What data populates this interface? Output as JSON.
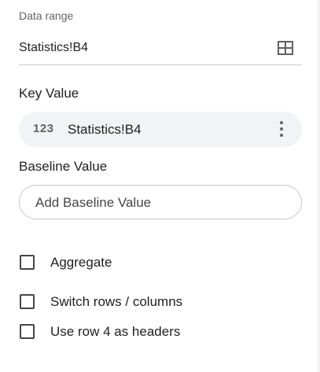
{
  "data_range": {
    "label": "Data range",
    "value": "Statistics!B4",
    "select_icon": "grid-icon"
  },
  "key_value": {
    "title": "Key Value",
    "chip_type_icon": "123",
    "chip_label": "Statistics!B4",
    "menu_icon": "more-vert-icon"
  },
  "baseline_value": {
    "title": "Baseline Value",
    "placeholder": "Add Baseline Value"
  },
  "options": [
    {
      "label": "Aggregate",
      "checked": false
    },
    {
      "label": "Switch rows / columns",
      "checked": false
    },
    {
      "label": "Use row 4 as headers",
      "checked": false
    }
  ],
  "colors": {
    "text": "#202124",
    "muted": "#5f6368",
    "chip_bg": "#f1f3f4",
    "border": "#c7c7c7"
  }
}
